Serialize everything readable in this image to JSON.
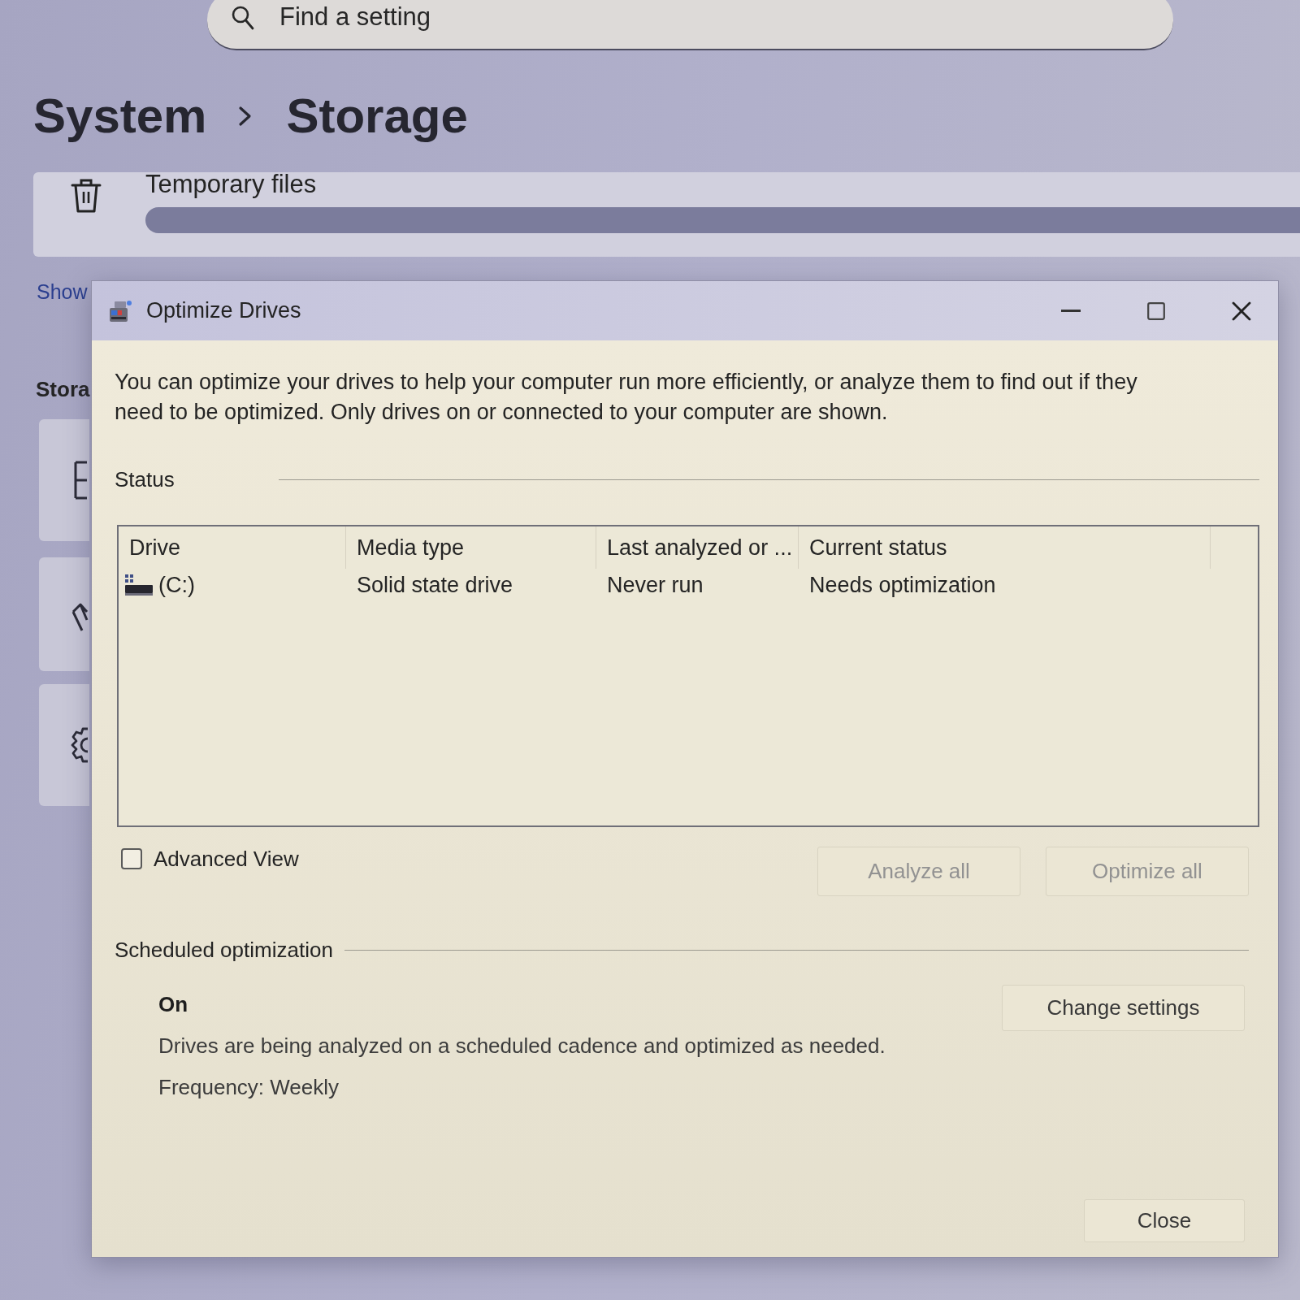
{
  "settings": {
    "search": {
      "placeholder": "Find a setting"
    },
    "breadcrumb": [
      {
        "label": "System"
      },
      {
        "label": "Storage"
      }
    ],
    "category": {
      "label": "Temporary files"
    },
    "link": "Show",
    "section_heading": "Stora"
  },
  "dialog": {
    "title": "Optimize Drives",
    "description": "You can optimize your drives to help your computer run more efficiently, or analyze them to find out if they need to be optimized. Only drives on or connected to your computer are shown.",
    "status_group": {
      "label": "Status",
      "table": {
        "columns": [
          "Drive",
          "Media type",
          "Last analyzed or ...",
          "Current status"
        ],
        "rows": [
          {
            "selected": false,
            "cells": [
              "(C:)",
              "Solid state drive",
              "Never run",
              "Needs optimization"
            ]
          }
        ]
      }
    },
    "advanced_view": {
      "label": "Advanced View",
      "checked": false
    },
    "actions": [
      {
        "label": "Analyze all",
        "disabled": true
      },
      {
        "label": "Optimize all",
        "disabled": true
      }
    ],
    "scheduled_optimization": {
      "label": "Scheduled optimization",
      "status": "On",
      "description": "Drives are being analyzed on a scheduled cadence and optimized as needed.",
      "frequency": "Frequency: Weekly",
      "button": {
        "label": "Change settings",
        "disabled": false
      }
    },
    "close_button": {
      "label": "Close",
      "disabled": false
    }
  }
}
